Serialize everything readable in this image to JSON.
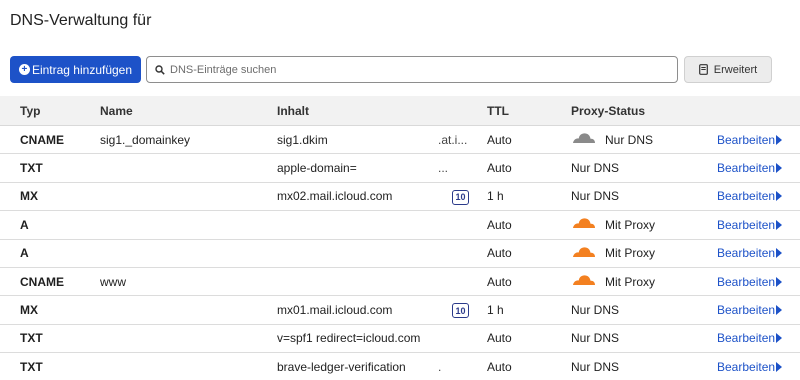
{
  "page_title": "DNS-Verwaltung für",
  "toolbar": {
    "add_label": "Eintrag hinzufügen",
    "search_placeholder": "DNS-Einträge suchen",
    "advanced_label": "Erweitert"
  },
  "columns": {
    "typ": "Typ",
    "name": "Name",
    "inhalt": "Inhalt",
    "ttl": "TTL",
    "proxy": "Proxy-Status"
  },
  "colors": {
    "accent": "#1d52c8",
    "proxy_orange": "#f38020",
    "dns_gray": "#8a8a8a"
  },
  "rows": [
    {
      "typ": "CNAME",
      "name": "sig1._domainkey",
      "inhalt": "sig1.dkim",
      "extra": ".at.i...",
      "prio": "",
      "ttl": "Auto",
      "proxy": "Nur DNS",
      "cloud": "gray",
      "edit": "Bearbeiten"
    },
    {
      "typ": "TXT",
      "name": "",
      "inhalt": "apple-domain=",
      "extra": "...",
      "prio": "",
      "ttl": "Auto",
      "proxy": "Nur DNS",
      "cloud": "none",
      "edit": "Bearbeiten"
    },
    {
      "typ": "MX",
      "name": "",
      "inhalt": "mx02.mail.icloud.com",
      "extra": "",
      "prio": "10",
      "ttl": "1 h",
      "proxy": "Nur DNS",
      "cloud": "none",
      "edit": "Bearbeiten"
    },
    {
      "typ": "A",
      "name": "",
      "inhalt": "",
      "extra": "",
      "prio": "",
      "ttl": "Auto",
      "proxy": "Mit Proxy",
      "cloud": "orange",
      "edit": "Bearbeiten"
    },
    {
      "typ": "A",
      "name": "",
      "inhalt": "",
      "extra": "",
      "prio": "",
      "ttl": "Auto",
      "proxy": "Mit Proxy",
      "cloud": "orange",
      "edit": "Bearbeiten"
    },
    {
      "typ": "CNAME",
      "name": "www",
      "inhalt": "",
      "extra": "",
      "prio": "",
      "ttl": "Auto",
      "proxy": "Mit Proxy",
      "cloud": "orange",
      "edit": "Bearbeiten"
    },
    {
      "typ": "MX",
      "name": "",
      "inhalt": "mx01.mail.icloud.com",
      "extra": "",
      "prio": "10",
      "ttl": "1 h",
      "proxy": "Nur DNS",
      "cloud": "none",
      "edit": "Bearbeiten"
    },
    {
      "typ": "TXT",
      "name": "",
      "inhalt": "v=spf1 redirect=icloud.com",
      "extra": "",
      "prio": "",
      "ttl": "Auto",
      "proxy": "Nur DNS",
      "cloud": "none",
      "edit": "Bearbeiten"
    },
    {
      "typ": "TXT",
      "name": "",
      "inhalt": "brave-ledger-verification",
      "extra": ".",
      "prio": "",
      "ttl": "Auto",
      "proxy": "Nur DNS",
      "cloud": "none",
      "edit": "Bearbeiten"
    }
  ]
}
